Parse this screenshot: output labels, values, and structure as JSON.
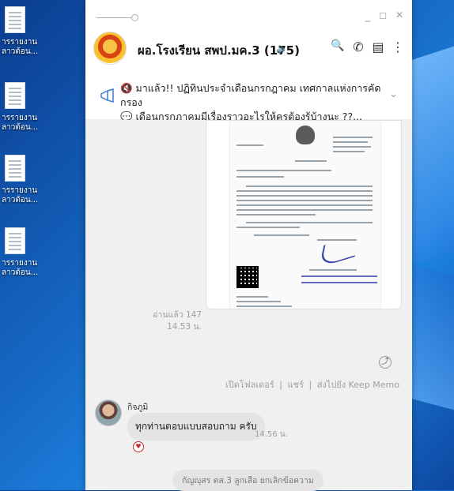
{
  "desktop": {
    "icons": [
      {
        "icon": "document-icon",
        "label1": "ารรายงาน",
        "label2": "ลาวต้อน..."
      },
      {
        "icon": "document-icon",
        "label1": "ารรายงาน",
        "label2": "ลาวต้อน..."
      },
      {
        "icon": "document-icon",
        "label1": "ารรายงาน",
        "label2": "ลาวต้อน..."
      },
      {
        "icon": "document-icon",
        "label1": "ารรายงาน",
        "label2": "ลาวต้อน..."
      }
    ]
  },
  "window": {
    "controls": {
      "minimize": "_",
      "maximize": "☐",
      "close": "✕"
    }
  },
  "chat_header": {
    "title": "ผอ.โรงเรียน สพป.มค.3 (175)",
    "mute_icon": "🔈",
    "search_icon": "🔍",
    "call_icon": "✆",
    "notes_icon": "▤",
    "more_icon": "⋮"
  },
  "announcement": {
    "line1": "🔇 มาแล้ว!! ปฏิทินประจำเดือนกรกฎาคม เทศกาลแห่งการคัดกรอง",
    "line2": "💬 เดือนกรกฎาคมมีเรื่องราวอะไรให้ครูต้องรู้บ้างนะ ??...",
    "chevron": "⌄"
  },
  "image_message": {
    "read_count": "อ่านแล้ว 147",
    "time": "14.53 น.",
    "share_icon": "⤴",
    "actions": {
      "open_folder": "เปิดโฟลเดอร์",
      "share": "แชร์",
      "keep": "ส่งไปยัง Keep Memo",
      "separator": "|"
    }
  },
  "text_message": {
    "sender": "กิจภูมิ",
    "text": "ทุกท่านตอบแบบสอบถาม  ครับ",
    "time": "14.56 น.",
    "reaction": "♥"
  },
  "system_message": {
    "text": "กัญญุสร ตส.3 ลูกเสือ ยกเลิกข้อความ"
  },
  "colors": {
    "accent": "#3b7dd8",
    "chat_bg": "#f0f0f0",
    "bubble_bg": "#e4e4e4",
    "desktop_bg": "#1565c0"
  }
}
